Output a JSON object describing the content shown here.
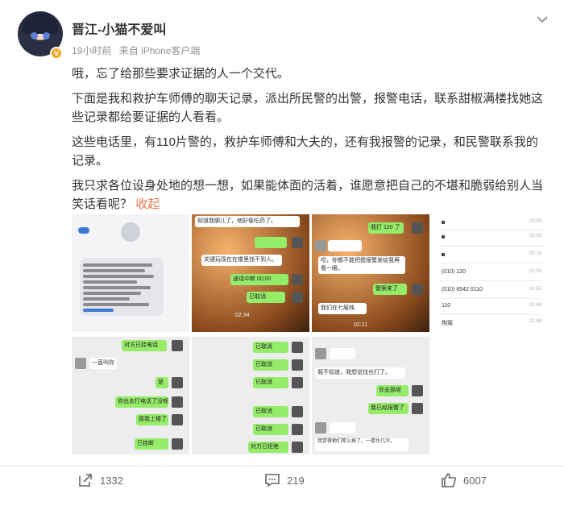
{
  "user": {
    "name": "晋江-小猫不爱叫",
    "badge": "v"
  },
  "meta": {
    "time": "19小时前",
    "source": "来自 iPhone客户端"
  },
  "post": {
    "p1": "哦，忘了给那些要求证据的人一个交代。",
    "p2": "下面是我和救护车师傅的聊天记录，派出所民警的出警，报警电话，联系甜椒满楼找她这些记录都给要证据的人看看。",
    "p3": "这些电话里，有110片警的，救护车师傅和大夫的，还有我报警的记录，和民警联系我的记录。",
    "p4": "我只求各位设身处地的想一想，如果能体面的活着，谁愿意把自己的不堪和脆弱给别人当笑话看呢？",
    "collapse": "收起"
  },
  "thumb2": {
    "top_text": "知道我聊儿了，他好像吃药了。",
    "msg_a": "关键玩现在在楼里找不到人。",
    "call_status": "通话中断 00:00",
    "cancelled": "已取消",
    "time": "02:34"
  },
  "thumb3": {
    "msg_a": "我打 120 了",
    "msg_b": "哎，你都不能把摁报警发给我再看一眼。",
    "msg_c": "警察来了",
    "msg_d": "我们在七层栈",
    "time": "02:21"
  },
  "thumb4": {
    "entries": [
      {
        "label": "",
        "time": "02:03"
      },
      {
        "label": "",
        "time": "02:03"
      },
      {
        "label": "",
        "time": "02:16"
      },
      {
        "label": "(010) 120",
        "time": "02:05"
      },
      {
        "label": "(010) 6542 0110",
        "time": "01:52"
      },
      {
        "label": "110",
        "time": "01:48"
      },
      {
        "label": "狗窝",
        "time": "01:48"
      }
    ]
  },
  "thumb5": {
    "msgs": [
      "对方已挂电话",
      "一直叫你",
      "是",
      "你出去打电话了没呢",
      "那我上楼了",
      "已挂断"
    ]
  },
  "thumb6": {
    "msgs": [
      "已取消",
      "已取消",
      "已取消",
      "已取消",
      "已取消",
      "对方已拒绝"
    ]
  },
  "thumb7": {
    "msgs": [
      "我不知道，我想说找也打了。",
      "你去那呢",
      "我已经报警了",
      "我觉得他们死么掉了，一楼住几冷。"
    ]
  },
  "actions": {
    "share": "1332",
    "comment": "219",
    "like": "6007"
  },
  "icons": {
    "more": "chevron-down-icon",
    "share": "share-icon",
    "comment": "comment-icon",
    "like": "thumbs-up-icon"
  },
  "colors": {
    "accent": "#eb7350",
    "badge": "#f5a623",
    "wechat_green": "#95ec69"
  }
}
